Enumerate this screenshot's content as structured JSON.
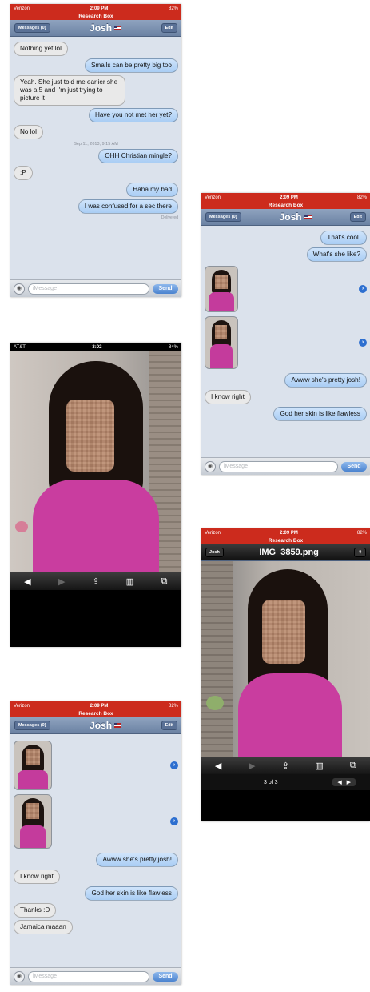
{
  "status": {
    "carrier": "Verizon",
    "time": "2:09 PM",
    "battery": "82%",
    "subtitle": "Research Box"
  },
  "status_att": {
    "carrier": "AT&T",
    "time": "3:02",
    "battery": "84%"
  },
  "nav": {
    "back": "Messages (0)",
    "title": "Josh",
    "edit": "Edit"
  },
  "input": {
    "placeholder": "iMessage",
    "send": "Send"
  },
  "screen1": {
    "messages": [
      {
        "side": "left",
        "text": "Nothing yet lol"
      },
      {
        "side": "right",
        "text": "Smalls can be pretty big too"
      },
      {
        "side": "left",
        "text": "Yeah. She just told me earlier she was a 5 and I'm just trying to picture it"
      },
      {
        "side": "right",
        "text": "Have you not met her yet?"
      },
      {
        "side": "left",
        "text": "No lol"
      }
    ],
    "timestamp": "Sep 11, 2013, 9:15 AM",
    "messages2": [
      {
        "side": "right",
        "text": "OHH Christian mingle?"
      },
      {
        "side": "left",
        "text": ":P"
      },
      {
        "side": "right",
        "text": "Haha my bad"
      },
      {
        "side": "right",
        "text": "I was confused for a sec there"
      }
    ],
    "delivered": "Delivered"
  },
  "screen2": {
    "top": [
      {
        "side": "right",
        "text": "That's cool."
      },
      {
        "side": "right",
        "text": "What's she like?"
      }
    ],
    "bottom": [
      {
        "side": "right",
        "text": "Awww she's pretty josh!"
      },
      {
        "side": "left",
        "text": "I know right"
      },
      {
        "side": "right",
        "text": "God her skin is like flawless"
      }
    ]
  },
  "viewer": {
    "back": "Josh",
    "filename": "IMG_3859.png",
    "counter": "3 of 3"
  },
  "screen5": {
    "bottom": [
      {
        "side": "right",
        "text": "Awww she's pretty josh!"
      },
      {
        "side": "left",
        "text": "I know right"
      },
      {
        "side": "right",
        "text": "God her skin is like flawless"
      },
      {
        "side": "left",
        "text": "Thanks :D"
      },
      {
        "side": "left",
        "text": "Jamaica maaan"
      }
    ]
  },
  "icons": {
    "camera": "camera-icon",
    "share": "share-icon",
    "book": "bookmarks-icon",
    "tabs": "tabs-icon",
    "back": "back-arrow-icon",
    "forward": "forward-arrow-icon",
    "disclosure": "disclosure-arrow-icon"
  },
  "colors": {
    "status_red": "#cc2b1d",
    "bubble_blue": "#a9cdf4",
    "bubble_gray": "#e9e9e9",
    "nav_blue": "#6b82a3"
  }
}
